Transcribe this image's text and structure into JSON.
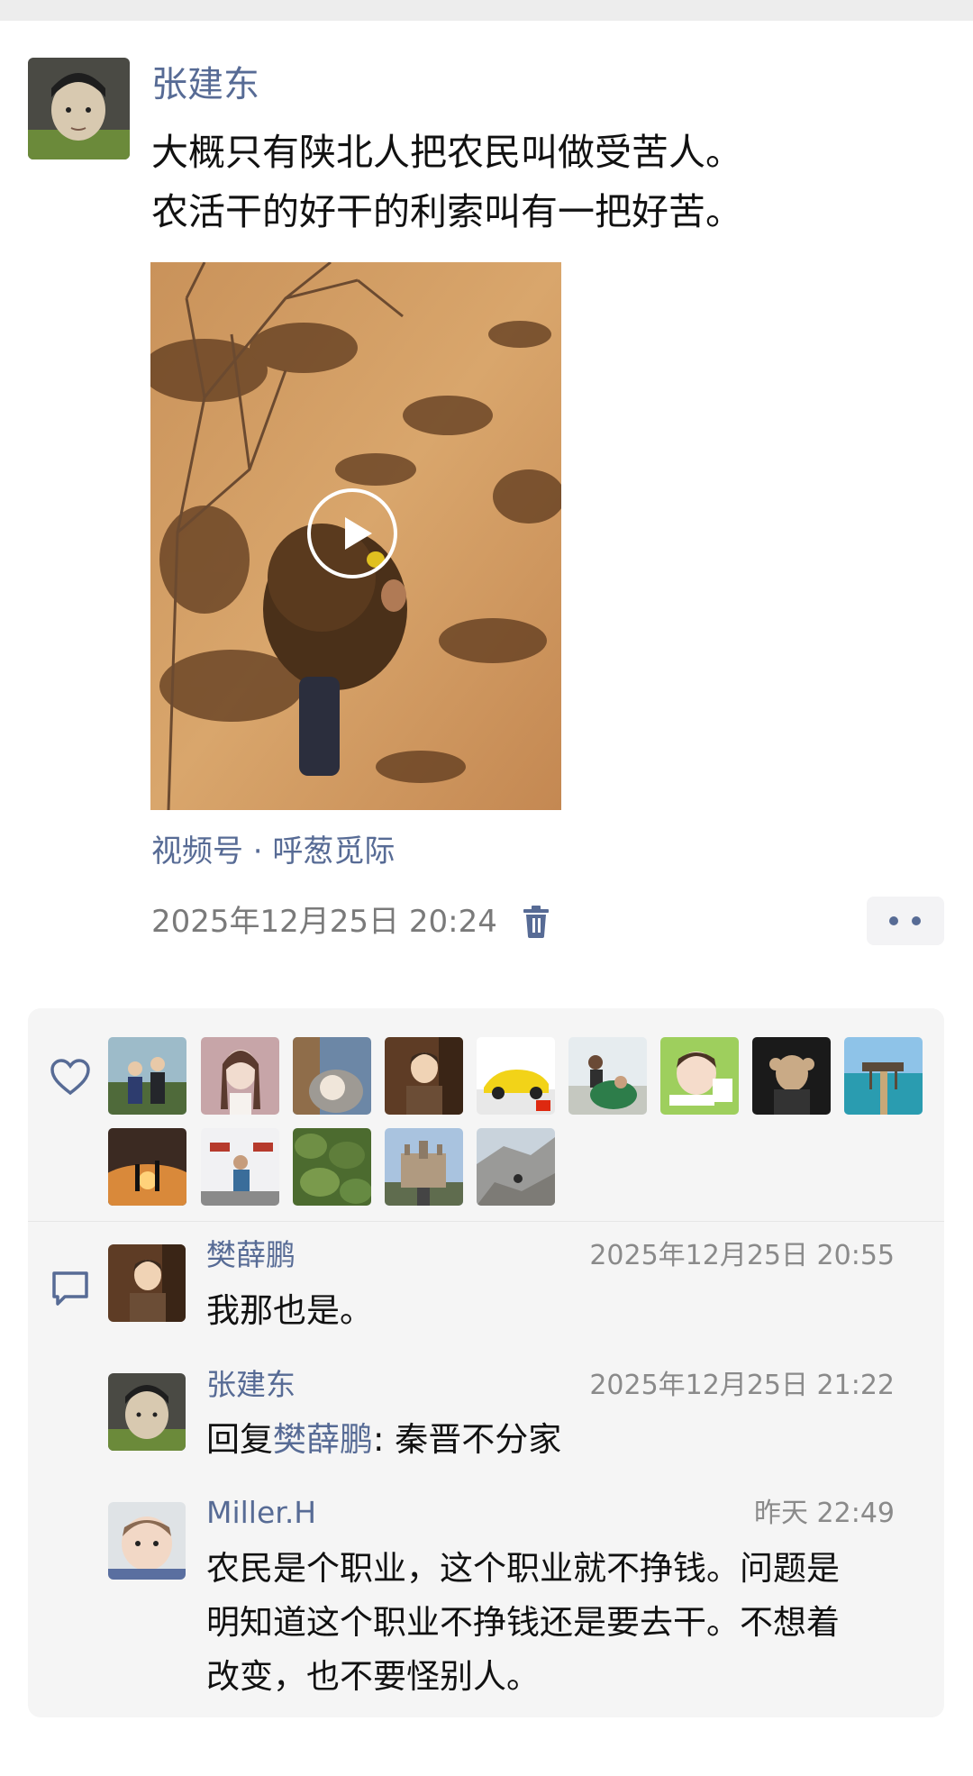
{
  "post": {
    "author": "张建东",
    "text_lines": [
      "大概只有陕北人把农民叫做受苦人。",
      "农活干的好干的利索叫有一把好苦。"
    ],
    "video": {
      "play_icon": "play-icon"
    },
    "source": "视频号 · 呼葱觅际",
    "timestamp": "2025年12月25日 20:24",
    "delete_icon": "trash-icon",
    "more_icon": "more-dots-icon"
  },
  "likes": {
    "icon": "heart-icon",
    "count_avatars": 14
  },
  "comments": [
    {
      "author": "樊薛鹏",
      "time": "2025年12月25日 20:55",
      "text": "我那也是。"
    },
    {
      "author": "张建东",
      "time": "2025年12月25日 21:22",
      "reply_prefix": "回复",
      "reply_to": "樊薛鹏",
      "text": ": 秦晋不分家"
    },
    {
      "author": "Miller.H",
      "time": "昨天 22:49",
      "text_lines": [
        "农民是个职业，这个职业就不挣钱。问题是",
        "明知道这个职业不挣钱还是要去干。不想着",
        "改变，也不要怪别人。"
      ]
    }
  ],
  "colors": {
    "link": "#576b95",
    "panel": "#f5f5f5",
    "text": "#111111",
    "meta": "#7a7a7a"
  }
}
